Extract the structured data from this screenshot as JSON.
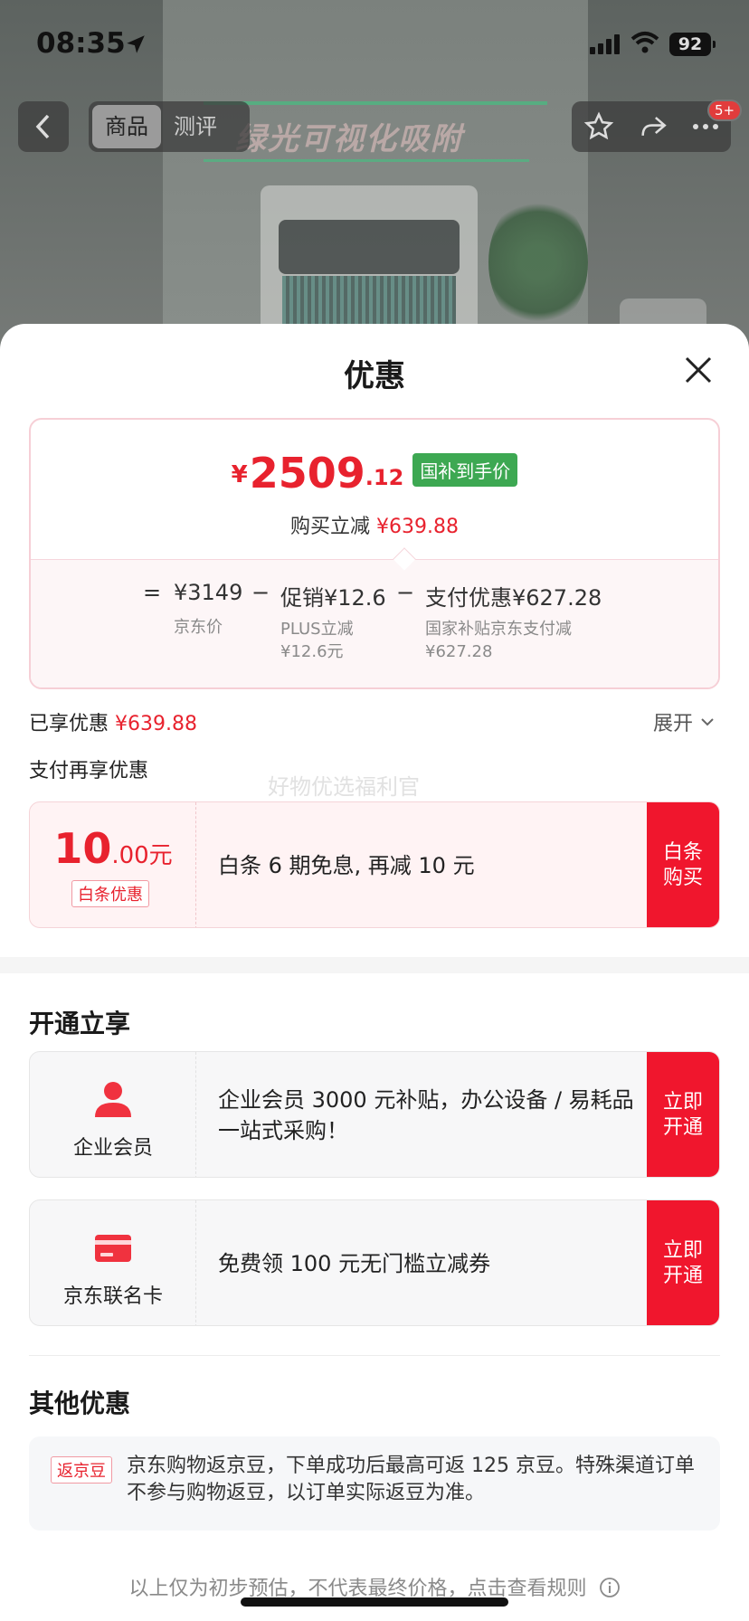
{
  "status_bar": {
    "time": "08:35",
    "battery": "92"
  },
  "background": {
    "banner_text": "绿光可视化吸附"
  },
  "nav": {
    "tabs": [
      {
        "label": "商品",
        "active": true
      },
      {
        "label": "测评",
        "active": false
      }
    ],
    "badge": "5+"
  },
  "sheet": {
    "title": "优惠"
  },
  "price_card": {
    "currency": "¥",
    "price_int": "2509",
    "price_dec": ".12",
    "tag": "国补到手价",
    "discount_label": "购买立减",
    "discount_value": "¥639.88",
    "formula": {
      "equals": "=",
      "base_value": "¥3149",
      "base_label": "京东价",
      "minus1": "−",
      "promo_value": "促销¥12.6",
      "promo_label_1": "PLUS立减",
      "promo_label_2": "¥12.6元",
      "minus2": "−",
      "pay_value": "支付优惠¥627.28",
      "pay_label_1": "国家补贴京东支付减",
      "pay_label_2": "¥627.28"
    }
  },
  "enjoyed": {
    "label": "已享优惠",
    "value": "¥639.88",
    "expand": "展开"
  },
  "pay_more": {
    "title": "支付再享优惠",
    "watermark": "好物优选福利官"
  },
  "baitiao_coupon": {
    "amount_int": "10",
    "amount_dec": ".00元",
    "tag": "白条优惠",
    "desc": "白条 6 期免息, 再减 10 元",
    "button": "白条购买"
  },
  "open_section": {
    "title": "开通立享",
    "items": [
      {
        "name": "企业会员",
        "icon": "person-icon",
        "desc": "企业会员 3000 元补贴，办公设备 / 易耗品一站式采购！",
        "button": "立即开通"
      },
      {
        "name": "京东联名卡",
        "icon": "card-icon",
        "desc": "免费领 100 元无门槛立减券",
        "button": "立即开通"
      }
    ]
  },
  "other": {
    "title": "其他优惠",
    "tag": "返京豆",
    "text": "京东购物返京豆，下单成功后最高可返 125 京豆。特殊渠道订单不参与购物返豆，以订单实际返豆为准。"
  },
  "disclaimer": "以上仅为初步预估，不代表最终价格，点击查看规则",
  "colors": {
    "accent_red": "#e8222e",
    "button_red": "#f0162d",
    "tag_green": "#3da852"
  }
}
